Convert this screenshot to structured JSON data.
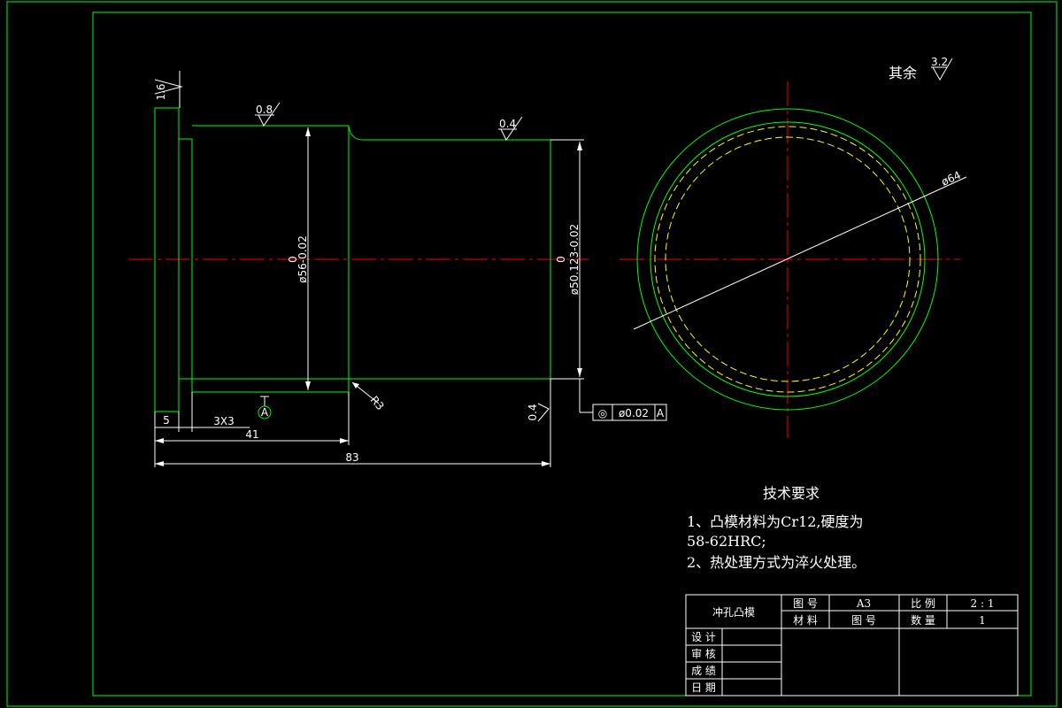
{
  "colors": {
    "outline": "#00ff00",
    "center_line": "#ff0000",
    "hidden_line": "#ffff00",
    "dimension": "#ffffff",
    "background": "#000000"
  },
  "surface_finish": {
    "rest_label": "其余",
    "rest_value": "3.2",
    "flange_face": "1.6",
    "large_dia": "0.8",
    "small_dia": "0.4",
    "end_face": "0.4"
  },
  "dimensions": {
    "large_dia_upper": "0",
    "large_dia": "ø56-0.02",
    "small_dia_upper": "0",
    "small_dia": "ø50.123-0.02",
    "fillet": "R3",
    "flange_width": "5",
    "chamfer": "3X3",
    "len_41": "41",
    "len_83": "83",
    "circle_dia": "ø64"
  },
  "datum": {
    "letter": "A"
  },
  "tolerance": {
    "symbol": "◎",
    "value": "ø0.02",
    "datum": "A"
  },
  "requirements": {
    "title": "技术要求",
    "line1": "1、凸模材料为Cr12,硬度为",
    "line2": "58-62HRC;",
    "line3": "2、热处理方式为淬火处理。"
  },
  "title_block": {
    "part_name": "冲孔凸模",
    "drawing_no_label": "图 号",
    "drawing_no_value": "A3",
    "scale_label": "比 例",
    "scale_value": "2 : 1",
    "material_label": "材 料",
    "material_value": "图 号",
    "quantity_label": "数 量",
    "quantity_value": "1",
    "design": "设 计",
    "review": "审 核",
    "grade": "成 绩",
    "date": "日 期"
  }
}
